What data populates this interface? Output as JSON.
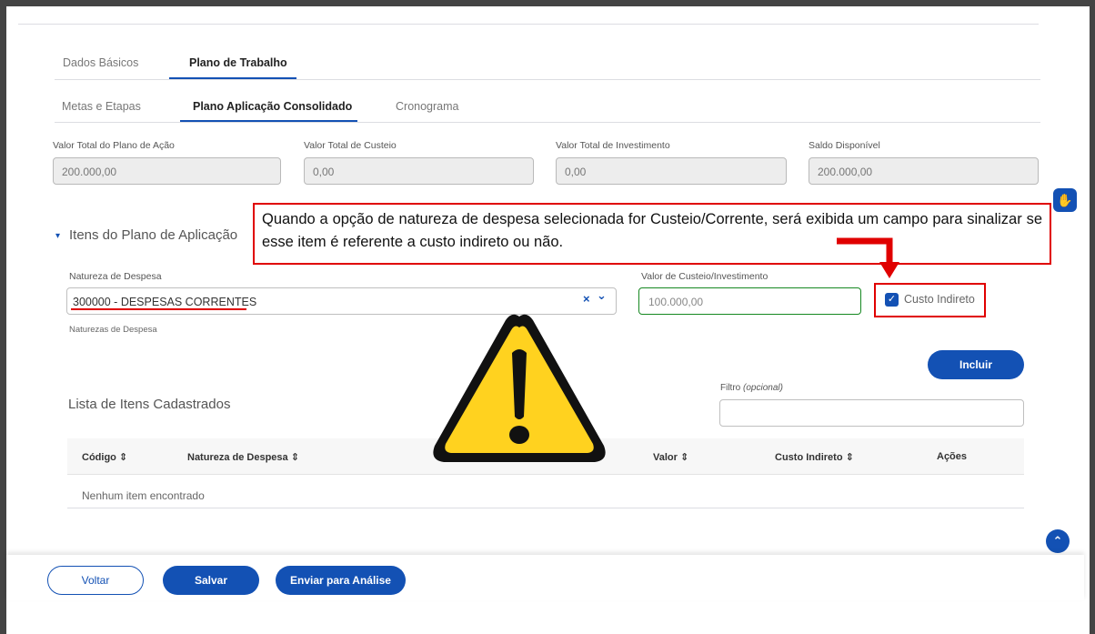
{
  "tabs_primary": [
    {
      "label": "Dados Básicos",
      "active": false
    },
    {
      "label": "Plano de Trabalho",
      "active": true
    }
  ],
  "tabs_secondary": [
    {
      "label": "Metas e Etapas",
      "active": false
    },
    {
      "label": "Plano Aplicação Consolidado",
      "active": true
    },
    {
      "label": "Cronograma",
      "active": false
    }
  ],
  "totals": [
    {
      "label": "Valor Total do Plano de Ação",
      "value": "200.000,00"
    },
    {
      "label": "Valor Total de Custeio",
      "value": "0,00"
    },
    {
      "label": "Valor Total de Investimento",
      "value": "0,00"
    },
    {
      "label": "Saldo Disponível",
      "value": "200.000,00"
    }
  ],
  "section": {
    "title": "Itens do Plano de Aplicação"
  },
  "callout": {
    "text": "Quando a opção de natureza de despesa selecionada for Custeio/Corrente, será exibida um campo para sinalizar se esse item é referente a custo indireto ou não."
  },
  "form": {
    "natureza_label": "Natureza de Despesa",
    "natureza_value": "300000 - DESPESAS CORRENTES",
    "natureza_helper": "Naturezas de Despesa",
    "clear_icon": "×",
    "dropdown_icon": "⌄",
    "valor_label": "Valor de Custeio/Investimento",
    "valor_value": "100.000,00",
    "custo_indireto_label": "Custo Indireto",
    "custo_indireto_checked": true,
    "checkmark": "✓",
    "incluir_label": "Incluir"
  },
  "list": {
    "title": "Lista de Itens Cadastrados",
    "filter_label": "Filtro",
    "filter_label_optional": "(opcional)",
    "columns": [
      "Código ⇕",
      "Natureza de Despesa ⇕",
      "Valor ⇕",
      "Custo Indireto ⇕",
      "Ações"
    ],
    "empty_text": "Nenhum item encontrado"
  },
  "footer": {
    "voltar_label": "Voltar",
    "salvar_label": "Salvar",
    "enviar_label": "Enviar para Análise"
  },
  "colors": {
    "primary": "#1351b4",
    "highlight_red": "#e00000",
    "success_green": "#168821",
    "warning_yellow": "#ffd21f"
  }
}
